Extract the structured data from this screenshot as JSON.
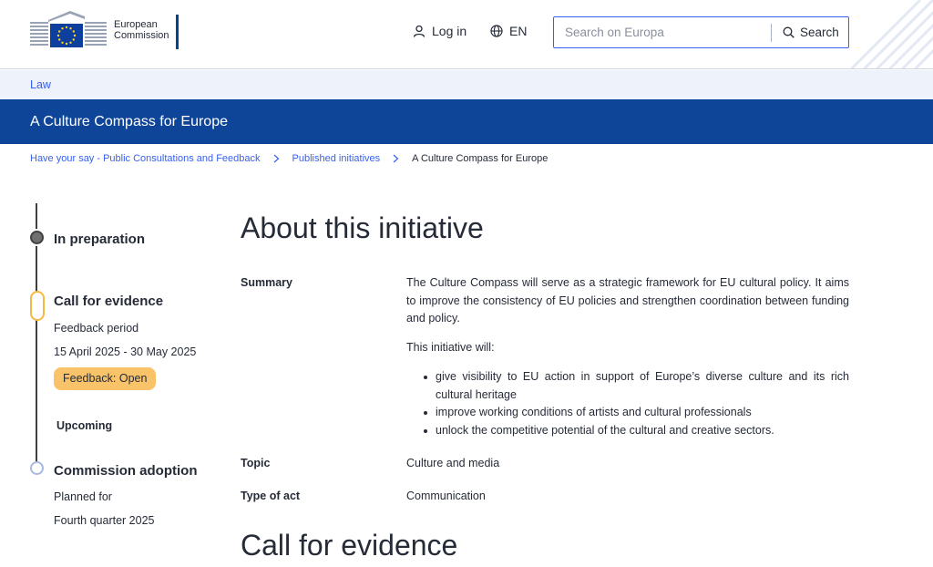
{
  "header": {
    "logo_line1": "European",
    "logo_line2": "Commission",
    "login_label": "Log in",
    "language_label": "EN",
    "search_placeholder": "Search on Europa",
    "search_button_label": "Search"
  },
  "site_bar": {
    "label": "Law"
  },
  "page_title": "A Culture Compass for Europe",
  "breadcrumb": [
    {
      "label": "Have your say - Public Consultations and Feedback"
    },
    {
      "label": "Published initiatives"
    },
    {
      "label": "A Culture Compass for Europe"
    }
  ],
  "timeline": {
    "stage1": {
      "title": "In preparation"
    },
    "stage2": {
      "title": "Call for evidence",
      "period_label": "Feedback period",
      "dates": "15 April 2025 - 30 May 2025",
      "status": "Feedback: Open"
    },
    "upcoming_label": "Upcoming",
    "stage3": {
      "title": "Commission adoption",
      "planned_label": "Planned for",
      "planned_value": "Fourth quarter 2025"
    }
  },
  "about": {
    "heading": "About this initiative",
    "summary_label": "Summary",
    "summary_text": "The Culture Compass will serve as a strategic framework for EU cultural policy. It aims to improve the consistency of EU policies and strengthen coordination between funding and policy.",
    "will_intro": "This initiative will:",
    "will_items": [
      "give visibility to EU action in support of Europe’s diverse culture and its rich cultural heritage",
      "improve working conditions of artists and cultural professionals",
      "unlock the competitive potential of the cultural and creative sectors."
    ],
    "topic_label": "Topic",
    "topic_value": "Culture and media",
    "type_label": "Type of act",
    "type_value": "Communication"
  },
  "call_heading": "Call for evidence",
  "colors": {
    "primary_blue": "#0f4599",
    "link_blue": "#3860ed",
    "site_bar_bg": "#eef2fb",
    "status_badge": "#f8c369",
    "stage_active_border": "#f4b942"
  }
}
